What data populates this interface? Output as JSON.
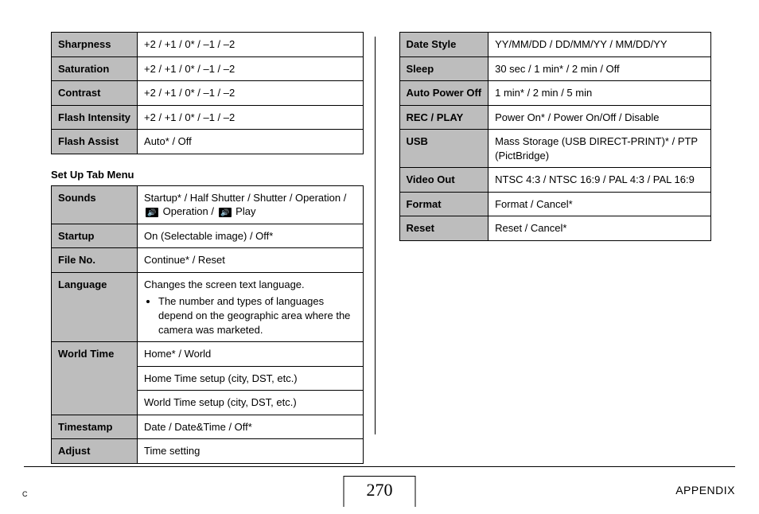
{
  "top_table": [
    {
      "label": "Sharpness",
      "value": "+2 / +1 / 0* / –1 / –2"
    },
    {
      "label": "Saturation",
      "value": "+2 / +1 / 0* / –1 / –2"
    },
    {
      "label": "Contrast",
      "value": "+2 / +1 / 0* / –1 / –2"
    },
    {
      "label": "Flash Intensity",
      "value": "+2 / +1 / 0* / –1 / –2"
    },
    {
      "label": "Flash Assist",
      "value": "Auto* / Off"
    }
  ],
  "setup_title": "Set Up Tab Menu",
  "setup_table": {
    "sounds_label": "Sounds",
    "sounds_line1_a": "Startup* / Half Shutter / Shutter / Operation /",
    "sounds_line1_b": " Operation / ",
    "sounds_line1_c": " Play",
    "startup_label": "Startup",
    "startup_value": "On (Selectable image) / Off*",
    "fileno_label": "File No.",
    "fileno_value": "Continue* / Reset",
    "language_label": "Language",
    "language_value": "Changes the screen text language.",
    "language_note": "The number and types of languages depend on the geographic area where the camera was marketed.",
    "worldtime_label": "World Time",
    "worldtime_r1": "Home* / World",
    "worldtime_r2": "Home Time setup (city, DST, etc.)",
    "worldtime_r3": "World Time setup (city, DST, etc.)",
    "timestamp_label": "Timestamp",
    "timestamp_value": "Date / Date&Time / Off*",
    "adjust_label": "Adjust",
    "adjust_value": "Time setting"
  },
  "right_table": [
    {
      "label": "Date Style",
      "value": "YY/MM/DD / DD/MM/YY / MM/DD/YY"
    },
    {
      "label": "Sleep",
      "value": "30 sec / 1 min* / 2 min / Off"
    },
    {
      "label": "Auto Power Off",
      "value": "1 min* / 2 min / 5 min"
    },
    {
      "label": "REC / PLAY",
      "value": "Power On* / Power On/Off / Disable"
    },
    {
      "label": "USB",
      "value": "Mass Storage (USB DIRECT-PRINT)* / PTP (PictBridge)"
    },
    {
      "label": "Video Out",
      "value": "NTSC 4:3 / NTSC 16:9 / PAL 4:3 / PAL 16:9"
    },
    {
      "label": "Format",
      "value": "Format / Cancel*"
    },
    {
      "label": "Reset",
      "value": "Reset / Cancel*"
    }
  ],
  "footer": {
    "c": "C",
    "page": "270",
    "appendix": "APPENDIX"
  }
}
